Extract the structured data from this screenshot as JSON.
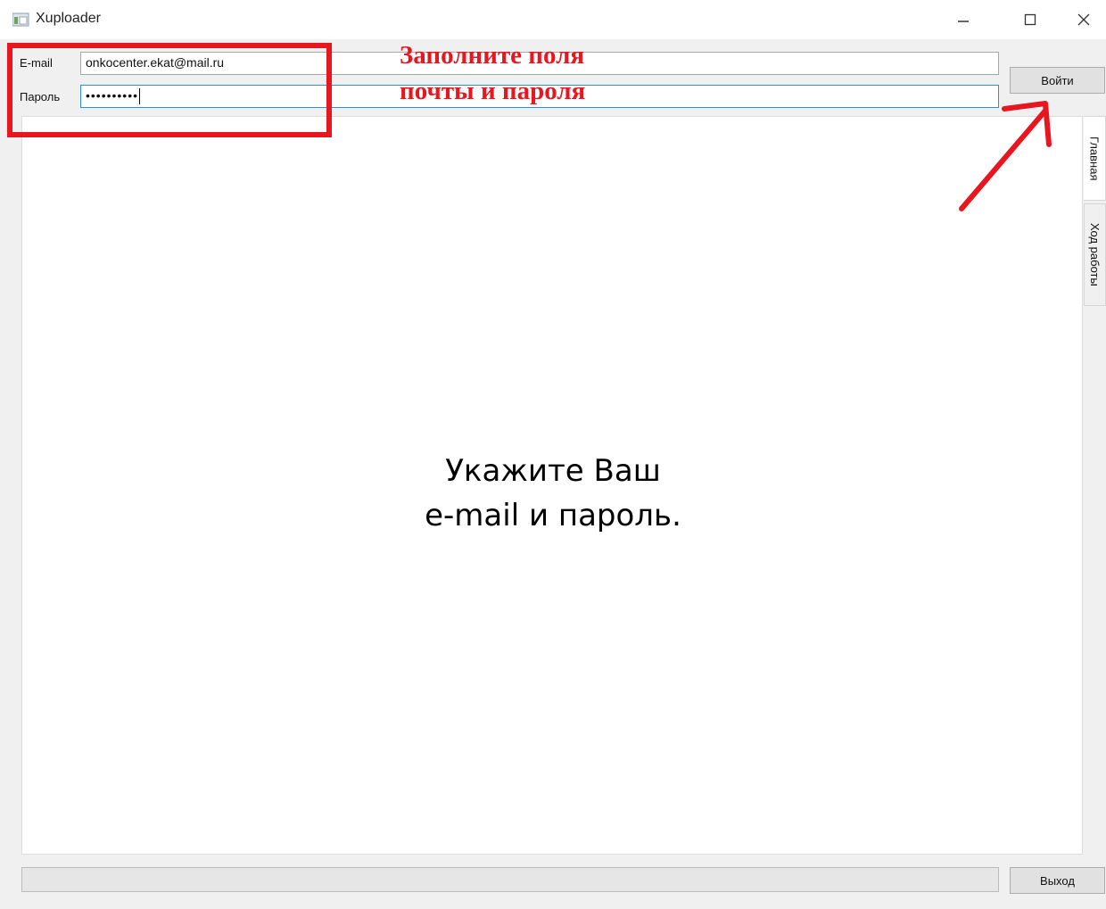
{
  "window": {
    "title": "Xuploader"
  },
  "login": {
    "email_label": "E-mail",
    "email_value": "onkocenter.ekat@mail.ru",
    "password_label": "Пароль",
    "password_value": "••••••••••",
    "login_button": "Войти"
  },
  "content": {
    "message_line1": "Укажите Ваш",
    "message_line2": "e-mail и пароль."
  },
  "tabs": [
    {
      "label": "Главная",
      "selected": true
    },
    {
      "label": "Ход работы",
      "selected": false
    }
  ],
  "footer": {
    "exit_button": "Выход"
  },
  "annotation": {
    "line1": "Заполните поля",
    "line2": "почты и пароля",
    "color": "#e8161f"
  },
  "icons": [
    "app-icon",
    "minimize-icon",
    "maximize-icon",
    "close-icon",
    "annotation-arrow-icon"
  ]
}
